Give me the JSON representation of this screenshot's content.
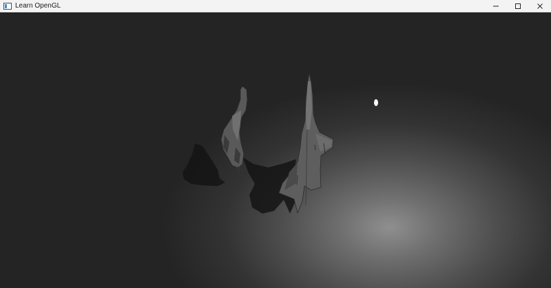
{
  "window": {
    "title": "Learn OpenGL",
    "controls": {
      "minimize": "minimize-icon",
      "maximize": "maximize-icon",
      "close": "close-icon"
    }
  },
  "scene": {
    "objects": [
      "light-source",
      "bird-model",
      "jet-model"
    ],
    "colors": {
      "floor_center": "#8f8f8f",
      "floor_edge": "#242424",
      "model_fill": "#5a5a5a",
      "shadow": "#141414",
      "light": "#ffffff"
    }
  }
}
